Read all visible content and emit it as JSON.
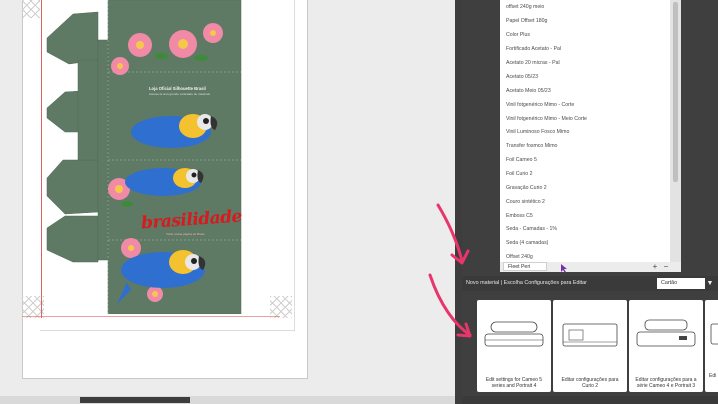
{
  "design": {
    "brand_title": "Loja Oficial Silhouette Brasil",
    "brand_subtitle": "Acesse lá uma grande variedade de materiais",
    "brasilidade": "brasilidade",
    "brasilidade_subtitle": "Visite nossa página de Brasil",
    "colors": {
      "background": "#5e7a64",
      "red_text": "#d71920",
      "bird_blue": "#2f6fd0",
      "bird_yellow": "#f3c22e"
    }
  },
  "materials": {
    "items": [
      "offset 240g meio",
      "Papel Offset 180g",
      "Color Plus",
      "Fortificado Acetato - Pal",
      "Acetato 20 micras - Pal",
      "Acetato 05/23",
      "Acetato Meio 05/23",
      "Vinil fotgenérico Mimo - Corte",
      "Vinil fotgenérico Mimo - Meio Corte",
      "Vinil Luminoso Fosco Mimo",
      "Transfer fosmco Mimo",
      "Foil Cameo 5",
      "Foil Curio 2",
      "Gravação Curio 2",
      "Couro sintético 2",
      "Emboss C5",
      "Seda - Camadas - 1%",
      "Seda (4 camadas)",
      "Offset 240g"
    ],
    "selected": "Fleet Peri",
    "add_label": "+",
    "remove_label": "−"
  },
  "settings": {
    "label": "Novo material | Escolha Configurações para Editar",
    "type_value": "Cartão",
    "type_arrow": "▼"
  },
  "cards": [
    {
      "label": "Edit settings for Cameo 5 series and Portrait 4",
      "icon": "cameo5-machine-icon"
    },
    {
      "label": "Editar configurações para Curio 2",
      "icon": "curio2-machine-icon"
    },
    {
      "label": "Editar configurações para a série Cameo 4 e Portrait 3",
      "icon": "cameo4-machine-icon"
    },
    {
      "label": "Edi",
      "icon": "partial-machine-icon"
    }
  ],
  "accent": {
    "arrow": "#e8356b",
    "panel": "#3f3f3f"
  }
}
